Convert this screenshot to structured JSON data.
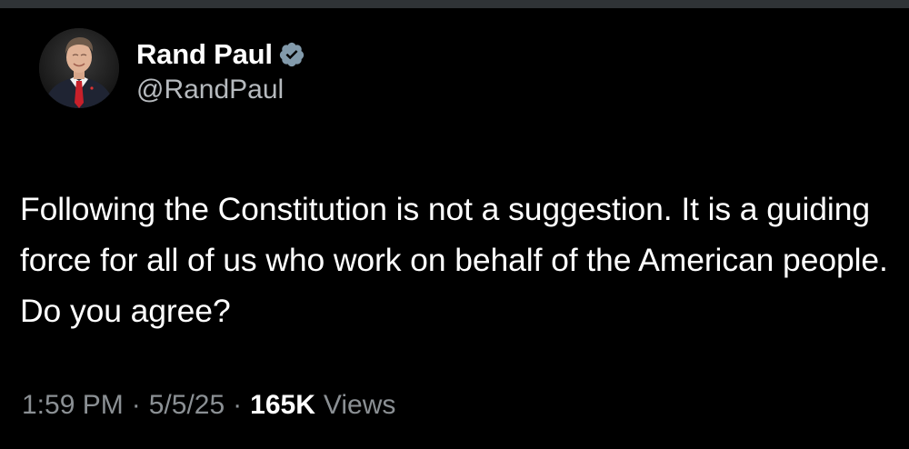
{
  "author": {
    "display_name": "Rand Paul",
    "handle": "@RandPaul",
    "verified": true,
    "avatar_icon": "profile-photo"
  },
  "tweet": {
    "text": "Following the Constitution is not a suggestion. It is a guiding force for all of us who work on behalf of the American people. Do you agree?",
    "time": "1:59 PM",
    "date": "5/5/25",
    "separator": "·",
    "views_count": "165K",
    "views_label": "Views"
  },
  "colors": {
    "background": "#000000",
    "text_primary": "#ffffff",
    "text_secondary": "#8b9094",
    "verified_badge": "#829aab"
  }
}
